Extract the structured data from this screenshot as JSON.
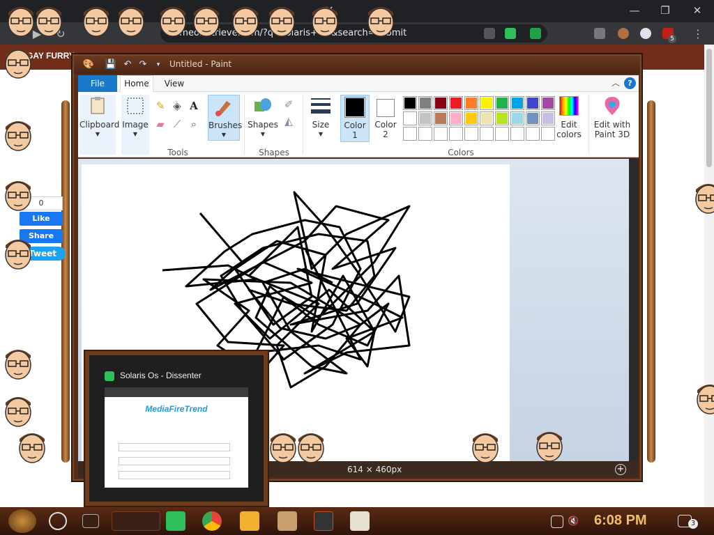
{
  "browser": {
    "address_url": "vimeo.retrieve.com/?q=solaris+OS&search=submit",
    "extension_badge_count": "5"
  },
  "page": {
    "nav_label": "GAY FURRY",
    "like_count": "0",
    "like_label": "Like",
    "share_label": "Share",
    "tweet_label": "Tweet"
  },
  "paint": {
    "title": "Untitled - Paint",
    "tabs": {
      "file": "File",
      "home": "Home",
      "view": "View"
    },
    "groups": {
      "clipboard": "Clipboard",
      "image": "Image",
      "tools": "Tools",
      "brushes": "Brushes",
      "shapes": "Shapes",
      "size": "Size",
      "color1": "Color 1",
      "color2": "Color 2",
      "colors": "Colors",
      "edit_colors": "Edit colors",
      "edit_paint3d": "Edit with Paint 3D"
    },
    "palette_row1": [
      "#000000",
      "#7f7f7f",
      "#880015",
      "#ed1c24",
      "#ff7f27",
      "#fff200",
      "#22b14c",
      "#00a2e8",
      "#3f48cc",
      "#a349a4"
    ],
    "palette_row2": [
      "#ffffff",
      "#c3c3c3",
      "#b97a57",
      "#ffaec9",
      "#ffc90e",
      "#efe4b0",
      "#b5e61d",
      "#99d9ea",
      "#7092be",
      "#c8bfe7"
    ],
    "palette_row3": [
      "#ffffff",
      "#ffffff",
      "#ffffff",
      "#ffffff",
      "#ffffff",
      "#ffffff",
      "#ffffff",
      "#ffffff",
      "#ffffff",
      "#ffffff"
    ],
    "color1_value": "#000000",
    "color2_value": "#ffffff",
    "canvas_size": "614 × 460px"
  },
  "preview": {
    "title": "Solaris Os - Dissenter",
    "site_title": "MediaFireTrend"
  },
  "taskbar": {
    "clock": "6:08 PM",
    "notification_count": "3"
  }
}
